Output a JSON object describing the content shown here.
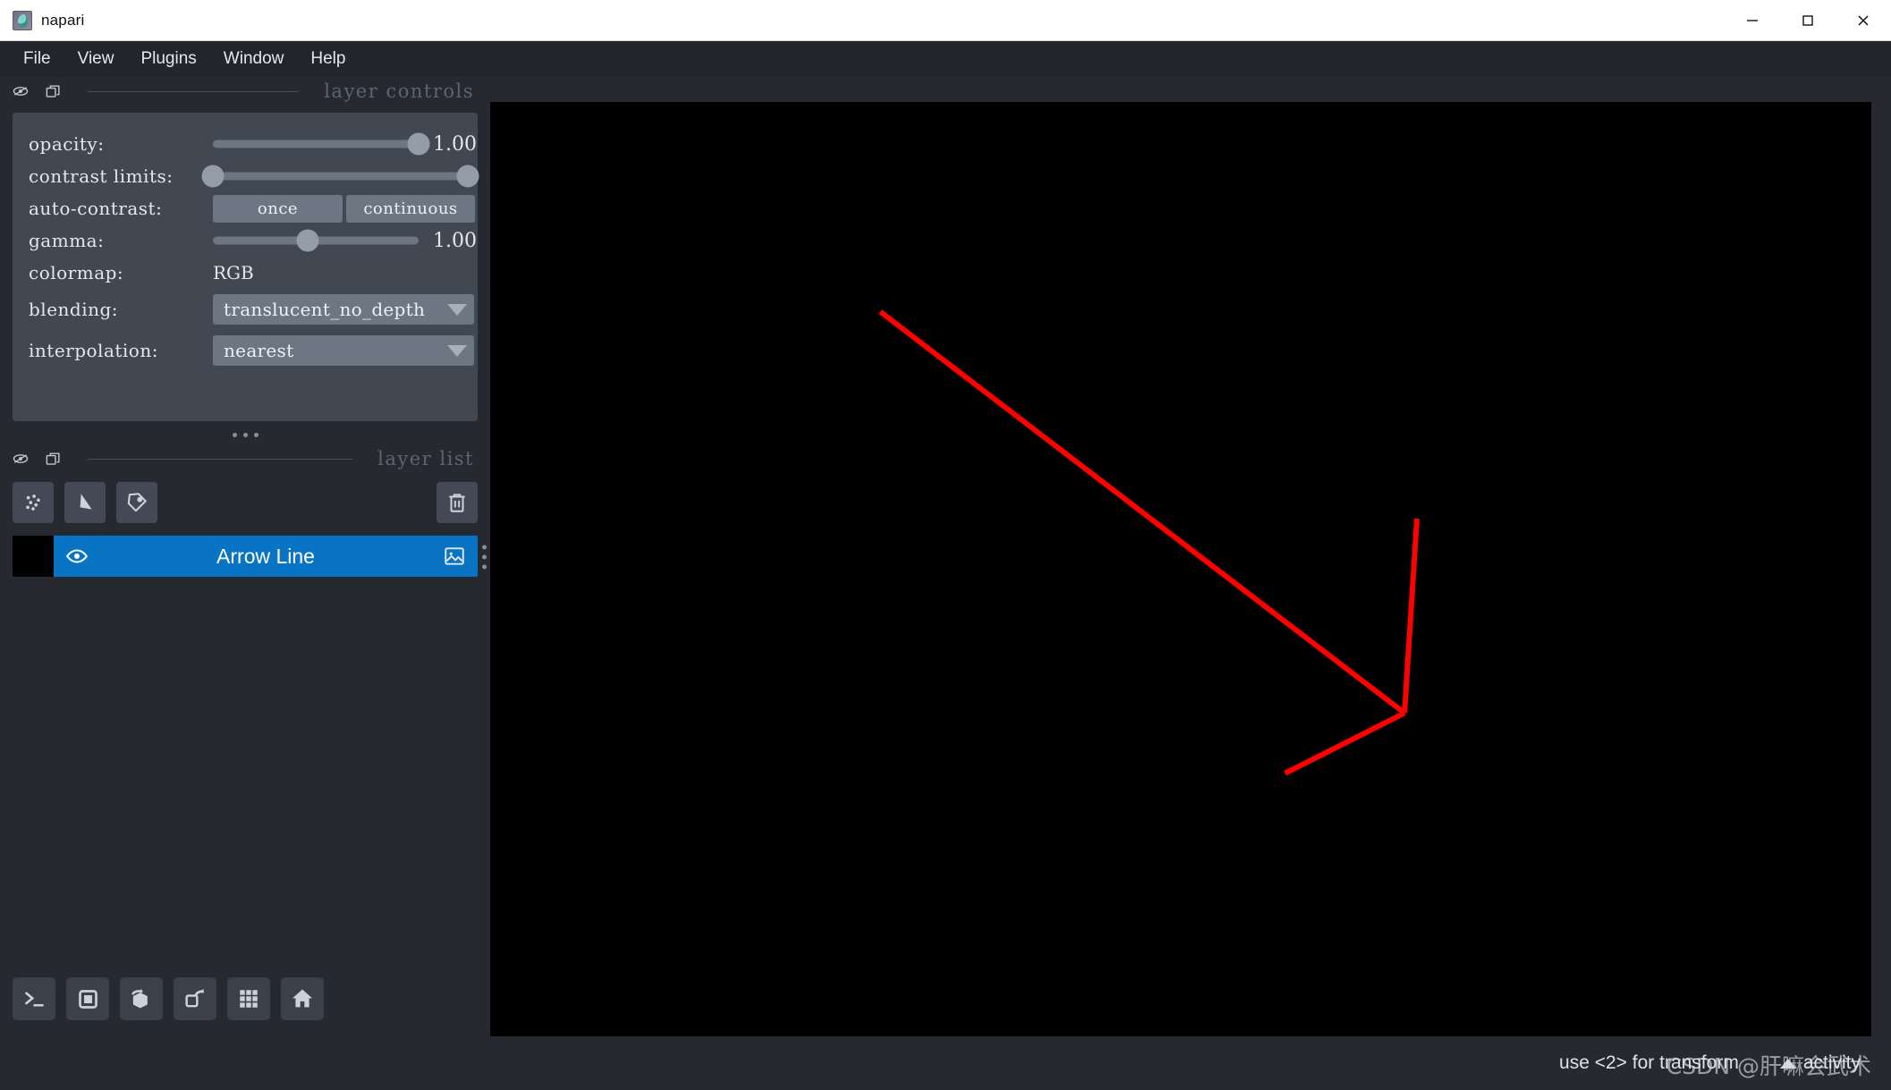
{
  "window": {
    "title": "napari",
    "icon": "napari-logo-icon",
    "controls": {
      "minimize": "minimize-icon",
      "maximize": "maximize-icon",
      "close": "close-icon"
    }
  },
  "menubar": {
    "items": [
      {
        "label": "File"
      },
      {
        "label": "View"
      },
      {
        "label": "Plugins"
      },
      {
        "label": "Window"
      },
      {
        "label": "Help"
      }
    ]
  },
  "layer_controls": {
    "dock_title": "layer controls",
    "dock_icons": [
      "hide-dock-icon",
      "float-dock-icon"
    ],
    "rows": {
      "opacity": {
        "label": "opacity:",
        "value": "1.00",
        "slider_percent": 100
      },
      "contrast_limits": {
        "label": "contrast limits:",
        "low_percent": 0,
        "high_percent": 100
      },
      "auto_contrast": {
        "label": "auto-contrast:",
        "once_label": "once",
        "continuous_label": "continuous"
      },
      "gamma": {
        "label": "gamma:",
        "value": "1.00",
        "slider_percent": 46
      },
      "colormap": {
        "label": "colormap:",
        "value": "RGB"
      },
      "blending": {
        "label": "blending:",
        "value": "translucent_no_depth"
      },
      "interpolation": {
        "label": "interpolation:",
        "value": "nearest"
      }
    }
  },
  "layer_list": {
    "dock_title": "layer list",
    "dock_icons": [
      "hide-dock-icon",
      "float-dock-icon"
    ],
    "toolbar": [
      {
        "name": "new-points-layer",
        "icon": "points-icon"
      },
      {
        "name": "new-shapes-layer",
        "icon": "shapes-icon"
      },
      {
        "name": "new-labels-layer",
        "icon": "labels-tag-icon"
      }
    ],
    "delete_button": {
      "name": "delete-layer",
      "icon": "trash-icon"
    },
    "layers": [
      {
        "name": "Arrow Line",
        "visible": true,
        "selected": true,
        "thumbnail_color": "#000000",
        "type_icon": "image-layer-icon"
      }
    ]
  },
  "viewer_toolbar": {
    "buttons": [
      {
        "name": "console-button",
        "icon": "terminal-icon"
      },
      {
        "name": "ndisplay-2d-button",
        "icon": "square-icon"
      },
      {
        "name": "roll-dims-button",
        "icon": "cube-rotate-icon"
      },
      {
        "name": "transpose-dims-button",
        "icon": "square-rotate-icon"
      },
      {
        "name": "grid-view-button",
        "icon": "grid-icon"
      },
      {
        "name": "home-reset-button",
        "icon": "home-icon"
      }
    ]
  },
  "canvas": {
    "background": "#000000",
    "shape_color": "#ff0000",
    "shape_width": 6,
    "shapes": [
      {
        "name": "arrow-shaft",
        "points": [
          [
            0.2825,
            0.2245
          ],
          [
            0.662,
            0.654
          ]
        ]
      },
      {
        "name": "arrow-head-upper",
        "points": [
          [
            0.671,
            0.446
          ],
          [
            0.662,
            0.654
          ]
        ]
      },
      {
        "name": "arrow-head-lower",
        "points": [
          [
            0.5755,
            0.7185
          ],
          [
            0.662,
            0.654
          ]
        ]
      }
    ]
  },
  "statusbar": {
    "help_text": "use <2> for transform",
    "activity_label": "activity",
    "activity_icon": "chevron-up-icon",
    "watermark": "CSDN @肝嘛会武术"
  }
}
